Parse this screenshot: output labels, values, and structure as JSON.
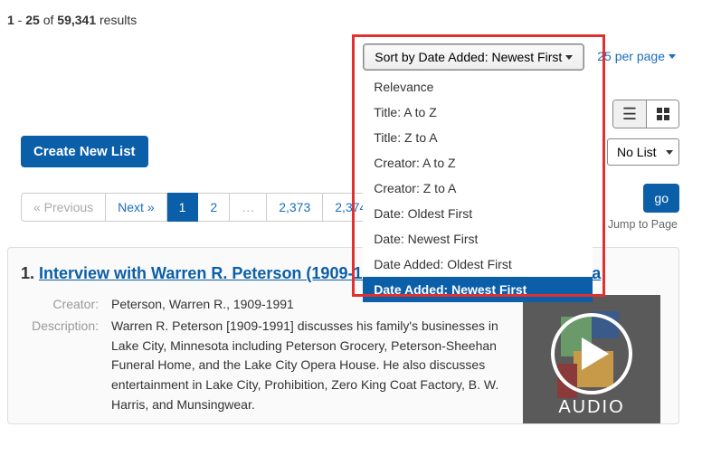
{
  "results": {
    "from": "1",
    "to": "25",
    "total": "59,341",
    "suffix": "results"
  },
  "sort": {
    "button_label": "Sort by Date Added: Newest First",
    "options": [
      "Relevance",
      "Title: A to Z",
      "Title: Z to A",
      "Creator: A to Z",
      "Creator: Z to A",
      "Date: Oldest First",
      "Date: Newest First",
      "Date Added: Oldest First",
      "Date Added: Newest First"
    ],
    "selected_index": 8
  },
  "per_page": {
    "label": "25 per page"
  },
  "list_controls": {
    "create_label": "Create New List",
    "current_list": "No List"
  },
  "pagination": {
    "prev": "« Previous",
    "next": "Next »",
    "pages": [
      "1",
      "2",
      "…",
      "2,373",
      "2,374"
    ],
    "active_index": 0,
    "go_label": "go",
    "jump_label": "Jump to Page"
  },
  "result_item": {
    "index": "1.",
    "title": "Interview with Warren R. Peterson (1909-1991) from Lake City, Minnesota",
    "creator_label": "Creator:",
    "creator": "Peterson, Warren R., 1909-1991",
    "description_label": "Description:",
    "description": "Warren R. Peterson [1909-1991] discusses his family's businesses in Lake City, Minnesota including Peterson Grocery, Peterson-Sheehan Funeral Home, and the Lake City Opera House. He also discusses entertainment in Lake City, Prohibition, Zero King Coat Factory, B. W. Harris, and Munsingwear.",
    "thumb_label": "AUDIO"
  }
}
